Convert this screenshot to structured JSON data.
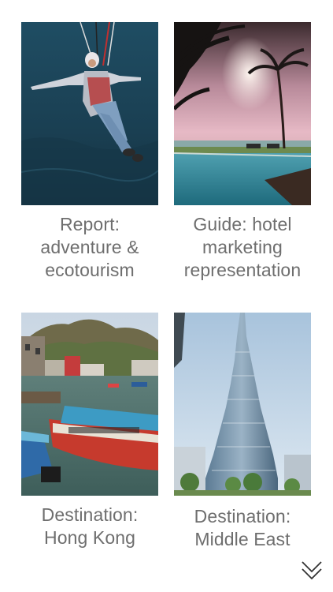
{
  "cards": [
    {
      "image": "adventure-zipline-photo",
      "caption_lines": [
        "Report:",
        "adventure &",
        "ecotourism"
      ]
    },
    {
      "image": "tropical-pool-sunset-photo",
      "caption_lines": [
        "Guide: hotel",
        "marketing",
        "representation"
      ]
    },
    {
      "image": "hong-kong-harbour-boats-photo",
      "caption_lines": [
        "Destination:",
        "Hong Kong"
      ]
    },
    {
      "image": "burj-khalifa-tower-photo",
      "caption_lines": [
        "Destination:",
        "Middle East"
      ]
    }
  ],
  "scroll_more_icon": "double-chevron-down-icon",
  "colors": {
    "caption_text": "#6e6e6e",
    "background": "#ffffff"
  }
}
